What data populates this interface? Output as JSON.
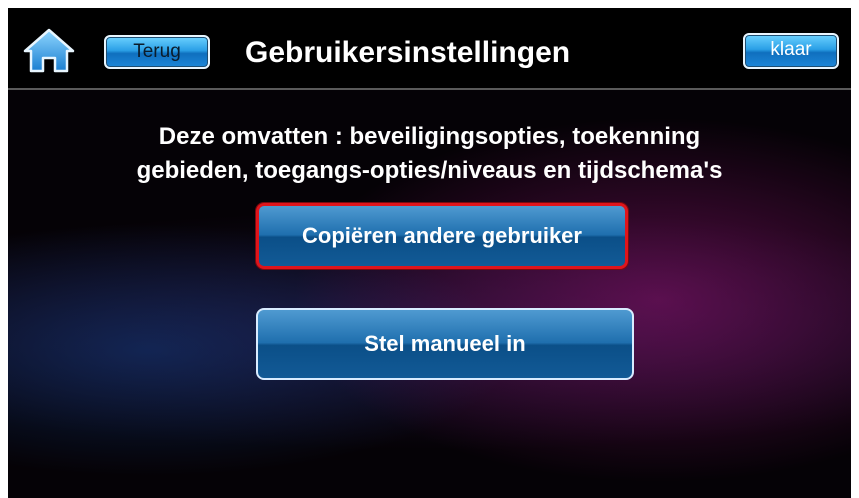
{
  "header": {
    "title": "Gebruikersinstellingen",
    "back_label": "Terug",
    "done_label": "klaar",
    "home_icon": "home-icon"
  },
  "main": {
    "intro_line1": "Deze omvatten : beveiligingsopties, toekenning",
    "intro_line2": "gebieden, toegangs-opties/niveaus en tijdschema's",
    "buttons": [
      {
        "label": "Copiëren andere gebruiker",
        "highlighted": true
      },
      {
        "label": "Stel manueel in",
        "highlighted": false
      }
    ]
  },
  "colors": {
    "accent_blue": "#2a9fe6",
    "highlight_red": "#e0141b",
    "background": "#000000"
  }
}
